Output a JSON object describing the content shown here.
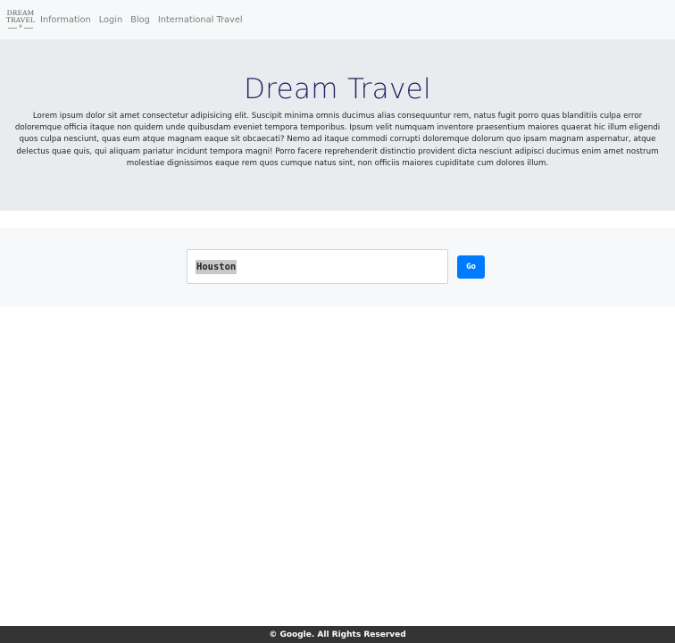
{
  "navbar": {
    "logo": {
      "line1": "DREAM",
      "line2": "TRAVEL"
    },
    "links": [
      "Information",
      "Login",
      "Blog",
      "International Travel"
    ]
  },
  "hero": {
    "title": "Dream Travel",
    "text": "Lorem ipsum dolor sit amet consectetur adipisicing elit. Suscipit minima omnis ducimus alias consequuntur rem, natus fugit porro quas blanditiis culpa error doloremque officia itaque non quidem unde quibusdam eveniet tempora temporibus. Ipsum velit numquam inventore praesentium maiores quaerat hic illum eligendi quos culpa nesciunt, quas eum atque magnam eaque sit obcaecati? Nemo ad itaque commodi corrupti doloremque dolorum quo ipsam magnam aspernatur, atque delectus quae quis, qui aliquam pariatur incidunt tempora magni! Porro facere reprehenderit distinctio provident dicta nesciunt adipisci ducimus enim amet nostrum molestiae dignissimos eaque rem quos cumque natus sint, non officiis maiores cupiditate cum dolores illum."
  },
  "search": {
    "value": "Houston",
    "button_label": "Go"
  },
  "footer": {
    "text": "© Google. All Rights Reserved"
  },
  "colors": {
    "navbar_bg": "#f7f8f9",
    "hero_bg": "#e9ecef",
    "title": "#242260",
    "button": "#007bff",
    "footer_bg": "#343434"
  }
}
